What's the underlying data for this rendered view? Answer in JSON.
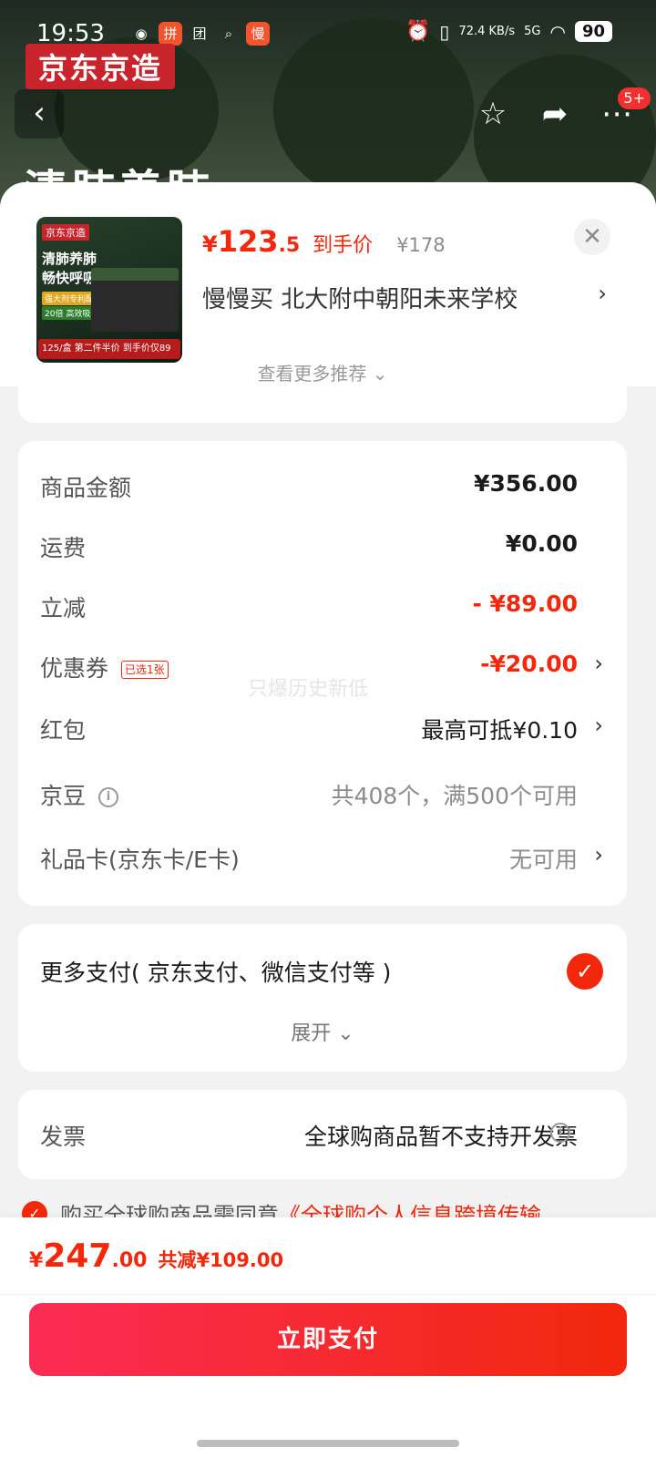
{
  "status_bar": {
    "time": "19:53",
    "app_icons": [
      "weibo-icon",
      "pinduoduo-icon",
      "tuan-icon",
      "search-icon",
      "man-icon"
    ],
    "network_speed": "72.4 KB/s",
    "signal": "5G",
    "battery": "90"
  },
  "background_page": {
    "brand": "京东京造",
    "headline": "清肺养肺",
    "badge_count": "5+"
  },
  "sheet": {
    "product": {
      "thumb_brand": "京东京造",
      "thumb_title": "清肺养肺\n畅快呼吸",
      "thumb_line1": "强大剂专利配方",
      "thumb_line2": "20倍 高效吸收",
      "thumb_bottom": "125/盒 第二件半价 到手价仅89",
      "price_yen": "¥",
      "price_int": "123",
      "price_dec": ".5",
      "price_label": "到手价",
      "original_price": "¥178"
    },
    "address": {
      "text": "慢慢买  北大附中朝阳未来学校"
    },
    "more_recommend": "查看更多推荐",
    "watermark": "只爆历史新低",
    "fees": {
      "goods_label": "商品金额",
      "goods_value": "¥356.00",
      "shipping_label": "运费",
      "shipping_value": "¥0.00",
      "discount_label": "立减",
      "discount_value": "- ¥89.00",
      "coupon_label": "优惠券",
      "coupon_tag": "已选1张",
      "coupon_value": "-¥20.00",
      "redpacket_label": "红包",
      "redpacket_value": "最高可抵¥0.10",
      "jingdou_label": "京豆",
      "jingdou_value": "共408个，满500个可用",
      "giftcard_label": "礼品卡(京东卡/E卡)",
      "giftcard_value": "无可用"
    },
    "payment": {
      "title": "更多支付( 京东支付、微信支付等 )",
      "expand": "展开"
    },
    "invoice": {
      "label": "发票",
      "value": "全球购商品暂不支持开发票"
    },
    "agreement": {
      "text": "购买全球购商品需同意",
      "link": "《全球购个人信息跨境传输"
    }
  },
  "bottom_bar": {
    "total_yen": "¥",
    "total_int": "247",
    "total_dec": ".00",
    "total_saving": "共减¥109.00",
    "pay_button": "立即支付"
  },
  "colors": {
    "accent_red": "#f2270c",
    "brand_red": "#c9242c"
  }
}
